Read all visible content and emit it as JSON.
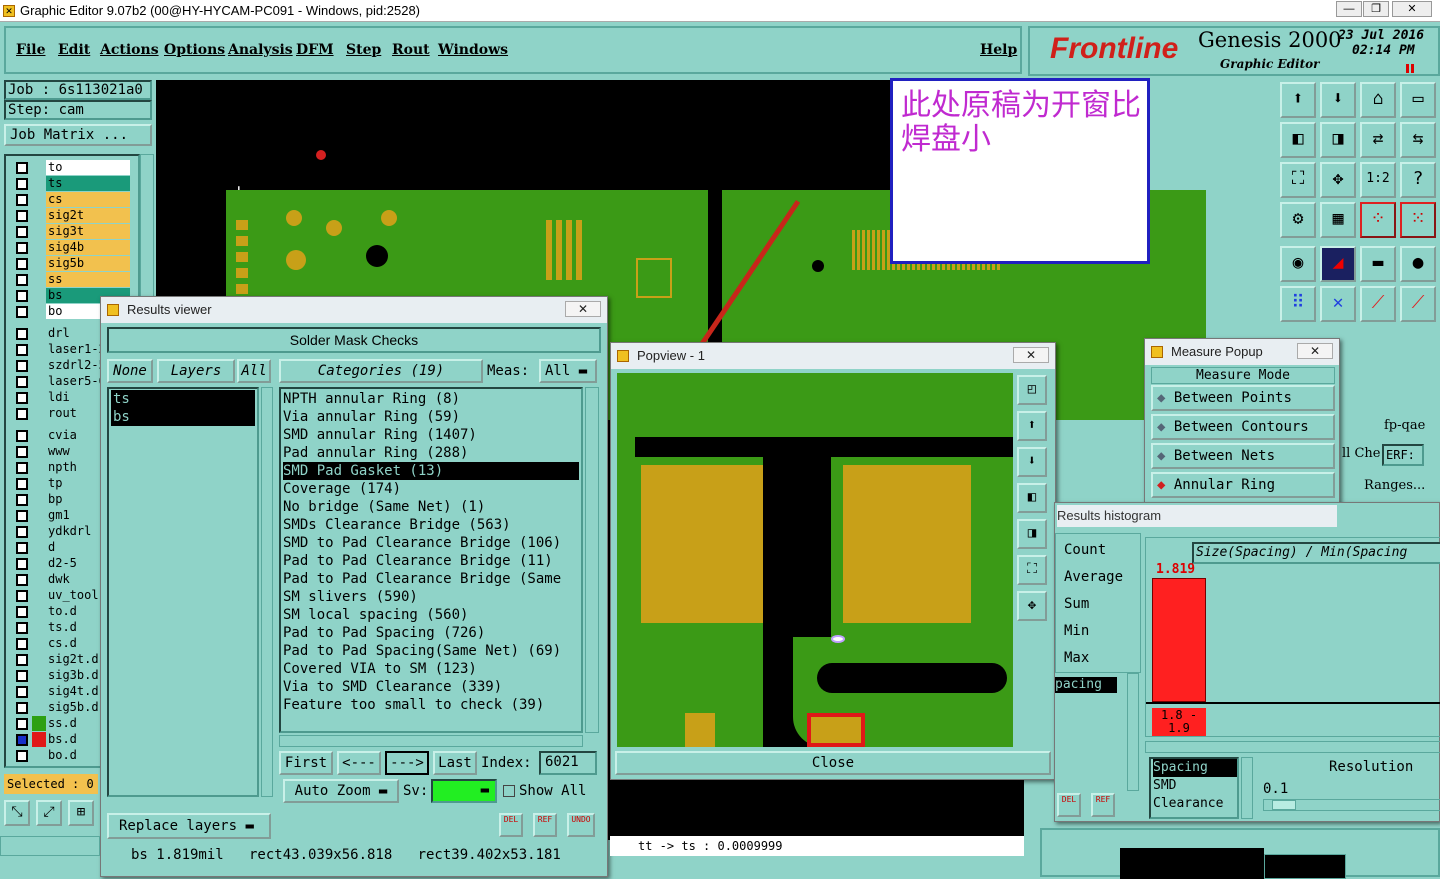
{
  "window": {
    "title": "Graphic Editor 9.07b2 (00@HY-HYCAM-PC091 - Windows, pid:2528)",
    "min": "—",
    "max": "❐",
    "close": "✕"
  },
  "menu": [
    "File",
    "Edit",
    "Actions",
    "Options",
    "Analysis",
    "DFM",
    "Step",
    "Rout",
    "Windows"
  ],
  "help": "Help",
  "brand": {
    "logo": "Frontline",
    "product": "Genesis 2000",
    "subtitle": "Graphic Editor",
    "date": "23 Jul 2016",
    "time": "02:14 PM"
  },
  "job": {
    "job": "Job : 6s113021a0",
    "step": "Step: cam",
    "matrix": "Job Matrix ..."
  },
  "layers": [
    {
      "name": "to",
      "color": "#ffffff"
    },
    {
      "name": "ts",
      "color": "#1a9a7a"
    },
    {
      "name": "cs",
      "color": "#f2c14e"
    },
    {
      "name": "sig2t",
      "color": "#f2c14e"
    },
    {
      "name": "sig3t",
      "color": "#f2c14e"
    },
    {
      "name": "sig4b",
      "color": "#f2c14e"
    },
    {
      "name": "sig5b",
      "color": "#f2c14e"
    },
    {
      "name": "ss",
      "color": "#f2c14e"
    },
    {
      "name": "bs",
      "color": "#1a9a7a"
    },
    {
      "name": "bo",
      "color": "#ffffff"
    }
  ],
  "layers2": [
    "drl",
    "laser1-2",
    "szdrl2-5",
    "laser5-6",
    "ldi",
    "rout"
  ],
  "layers3": [
    "cvia",
    "www",
    "npth",
    "tp",
    "bp",
    "gm1",
    "ydkdrl",
    "d",
    "d2-5",
    "dwk",
    "uv_tool",
    "to.d",
    "ts.d",
    "cs.d",
    "sig2t.d",
    "sig3b.d",
    "sig4t.d",
    "sig5b.d",
    "ss.d",
    "bs.d",
    "bo.d"
  ],
  "selected": "Selected : 0",
  "annotation": "此处原稿为开窗比焊盘小",
  "results": {
    "title": "Results viewer",
    "header": "Solder Mask Checks",
    "none": "None",
    "layers": "Layers",
    "all": "All",
    "categories": "Categories (19)",
    "meas": "Meas:",
    "meas_val": "All",
    "layer_list": [
      "ts",
      "bs"
    ],
    "items": [
      "NPTH annular Ring (8)",
      "Via annular Ring (59)",
      "SMD annular Ring (1407)",
      "Pad annular Ring (288)",
      "SMD Pad Gasket (13)",
      "Coverage (174)",
      "No bridge (Same Net) (1)",
      "SMDs Clearance Bridge (563)",
      "SMD to Pad Clearance Bridge (106)",
      "Pad to Pad Clearance Bridge (11)",
      "Pad to Pad Clearance Bridge (Same",
      "SM slivers (590)",
      "SM local spacing (560)",
      "Pad to Pad Spacing (726)",
      "Pad to Pad Spacing(Same Net) (69)",
      "Covered VIA to SM (123)",
      "Via to SMD Clearance (339)",
      "Feature too small to check (39)"
    ],
    "first": "First",
    "prev": "<---",
    "next": "--->",
    "last": "Last",
    "index_label": "Index:",
    "index": "6021",
    "autozoom": "Auto Zoom",
    "sv": "Sv:",
    "showall": "Show All",
    "replace": "Replace layers",
    "del": "DEL",
    "ref": "REF",
    "undo": "UNDO"
  },
  "status": {
    "bar": "bs 1.819mil   rect43.039x56.818   rect39.402x53.181",
    "tt": "tt -> ts : 0.0009999"
  },
  "popview": {
    "title": "Popview - 1",
    "close": "Close"
  },
  "measure": {
    "title": "Measure Popup",
    "header": "Measure Mode",
    "modes": [
      "Between Points",
      "Between Contours",
      "Between Nets",
      "Annular Ring"
    ],
    "qae": "fp-qae",
    "che": "ll Che",
    "erf": "ERF:",
    "ranges": "Ranges..."
  },
  "histogram": {
    "title": "Results histogram",
    "stats": [
      "Count",
      "Average",
      "Sum",
      "Min",
      "Max"
    ],
    "spacing": "pacing",
    "axis": "Size(Spacing) / Min(Spacing",
    "bar_value": "1.819",
    "range": "1.8 - 1.9",
    "list": [
      "Spacing",
      "SMD",
      "Clearance"
    ],
    "resolution": "Resolution",
    "res_val": "0.1",
    "del": "DEL",
    "ref": "REF"
  }
}
